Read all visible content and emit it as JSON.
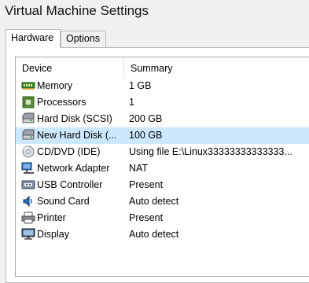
{
  "window": {
    "title": "Virtual Machine Settings"
  },
  "tabs": [
    {
      "label": "Hardware"
    },
    {
      "label": "Options"
    }
  ],
  "table": {
    "headers": {
      "device": "Device",
      "summary": "Summary"
    },
    "rows": [
      {
        "device": "Memory",
        "summary": "1 GB",
        "icon": "memory-icon"
      },
      {
        "device": "Processors",
        "summary": "1",
        "icon": "processor-icon"
      },
      {
        "device": "Hard Disk (SCSI)",
        "summary": "200 GB",
        "icon": "hard-disk-icon"
      },
      {
        "device": "New Hard Disk (...",
        "summary": "100 GB",
        "icon": "hard-disk-icon",
        "selected": true
      },
      {
        "device": "CD/DVD (IDE)",
        "summary": "Using file E:\\Linux33333333333333...",
        "icon": "cd-dvd-icon"
      },
      {
        "device": "Network Adapter",
        "summary": "NAT",
        "icon": "network-adapter-icon"
      },
      {
        "device": "USB Controller",
        "summary": "Present",
        "icon": "usb-icon"
      },
      {
        "device": "Sound Card",
        "summary": "Auto detect",
        "icon": "sound-card-icon"
      },
      {
        "device": "Printer",
        "summary": "Present",
        "icon": "printer-icon"
      },
      {
        "device": "Display",
        "summary": "Auto detect",
        "icon": "display-icon"
      }
    ]
  },
  "colors": {
    "selection": "#cce8ff",
    "accent": "#2a6fb8"
  }
}
